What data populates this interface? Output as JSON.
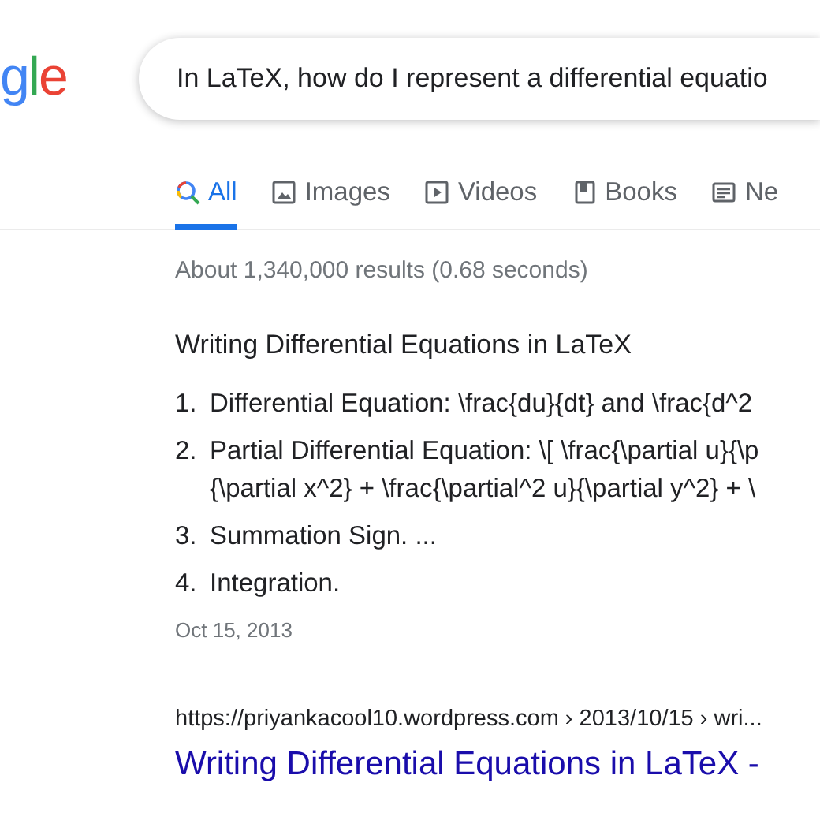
{
  "logo": {
    "letters": [
      {
        "char": "g",
        "color": "#4285f4"
      },
      {
        "char": "l",
        "color": "#34a853"
      },
      {
        "char": "e",
        "color": "#ea4335"
      }
    ]
  },
  "search": {
    "value": "In LaTeX, how do I represent a differential equatio"
  },
  "tabs": [
    {
      "label": "All",
      "kind": "all",
      "selected": true
    },
    {
      "label": "Images",
      "kind": "images",
      "selected": false
    },
    {
      "label": "Videos",
      "kind": "videos",
      "selected": false
    },
    {
      "label": "Books",
      "kind": "books",
      "selected": false
    },
    {
      "label": "Ne",
      "kind": "news",
      "selected": false
    }
  ],
  "result_stats": "About 1,340,000 results (0.68 seconds)",
  "featured_snippet": {
    "heading": "Writing Differential Equations in LaTeX",
    "items": [
      {
        "number": "1.",
        "lines": [
          "Differential Equation: \\frac{du}{dt} and \\frac{d^2"
        ]
      },
      {
        "number": "2.",
        "lines": [
          "Partial Differential Equation: \\[ \\frac{\\partial u}{\\p",
          "{\\partial x^2} + \\frac{\\partial^2 u}{\\partial y^2} + \\"
        ]
      },
      {
        "number": "3.",
        "lines": [
          "Summation Sign. ..."
        ]
      },
      {
        "number": "4.",
        "lines": [
          "Integration."
        ]
      }
    ],
    "date": "Oct 15, 2013",
    "url": "https://priyankacool10.wordpress.com › 2013/10/15 › wri...",
    "title": "Writing Differential Equations in LaTeX -"
  }
}
